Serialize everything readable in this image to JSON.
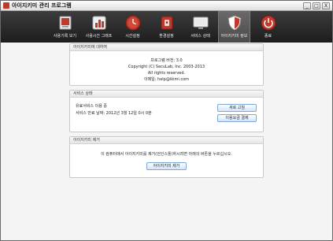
{
  "window": {
    "title": "아이지키미 관리 프로그램",
    "controls": [
      "_",
      "□",
      "X"
    ]
  },
  "toolbar": {
    "items": [
      {
        "label": "사용기록 보기",
        "icon": "monitor-icon"
      },
      {
        "label": "사용시간 그래프",
        "icon": "bar-chart-icon"
      },
      {
        "label": "시간설정",
        "icon": "clock-icon"
      },
      {
        "label": "환경설정",
        "icon": "lock-icon"
      },
      {
        "label": "서비스 상태",
        "icon": "display-icon"
      },
      {
        "label": "아이지키미 정보",
        "icon": "shield-icon",
        "active": true
      },
      {
        "label": "종료",
        "icon": "power-icon"
      }
    ]
  },
  "about": {
    "header": "아이지키미에 대하여",
    "version": "프로그램 버전: 3.0",
    "copyright": "Copyright (C) SecuLab, Inc. 2003-2013",
    "rights": "All rights reserved.",
    "email": "이메일: help@ikimi.com"
  },
  "service": {
    "header": "서비스 상태",
    "status": "유료서비스 이용 중",
    "expiry": "서비스 만료 날짜: 2012년 3월 12일 0시 0분",
    "renew_button": "새로 고침",
    "pay_button": "이용요금 결제"
  },
  "remove": {
    "header": "아이지키미 제거",
    "message": "이 컴퓨터에서 아이지키미를 제거(언인스톨)하시려면 아래의 버튼을 누르십시오.",
    "button": "아이지키미 제거"
  },
  "colors": {
    "toolbar_bg": "#2a2a2a",
    "active_tab": "#5a5a5a",
    "accent_red": "#c0392b",
    "button_border": "#7fa7d8"
  }
}
